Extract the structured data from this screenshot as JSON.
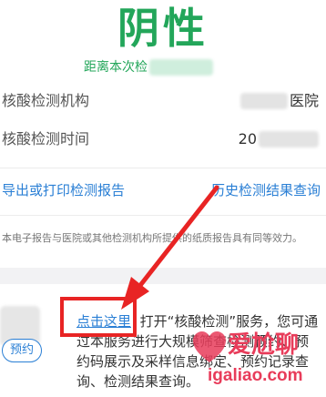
{
  "result": {
    "status": "阴性",
    "distance_label": "距离本次检",
    "institution_label": "核酸检测机构",
    "institution_value": "医院",
    "time_label": "核酸检测时间",
    "time_value": "20"
  },
  "links": {
    "export": "导出或打印检测报告",
    "history": "历史检测结果查询"
  },
  "disclaimer": "本电子报告与医院或其他检测机构所提供的纸质报告具有同等效力。",
  "service": {
    "link_text": "点击这里",
    "line1_rest": "打开“核酸检测”服务，您可通",
    "line2": "过本服务进行大规模筛查检测预约、预",
    "line3": "约码展示及采样信息绑定、预约记录查",
    "line4": "询、检测结果查询。",
    "appointment_button": "预约"
  },
  "watermark": {
    "brand": "爱尬聊",
    "domain": "igaliao.com"
  },
  "colors": {
    "result_green": "#23a65a",
    "link_blue": "#2a7fd5",
    "annotation_red": "#e82424",
    "watermark_pink": "#e83c5a"
  }
}
